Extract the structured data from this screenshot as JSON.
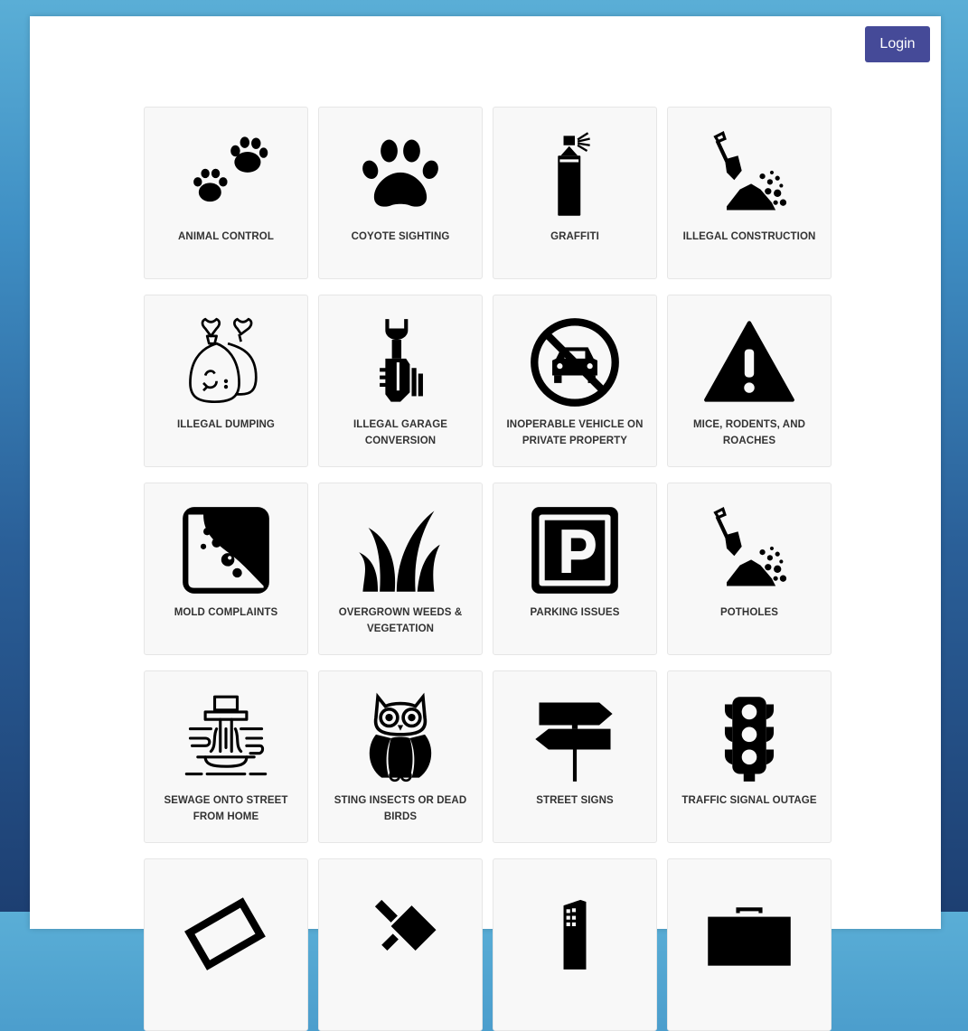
{
  "header": {
    "login_label": "Login"
  },
  "services": [
    {
      "label": "ANIMAL CONTROL",
      "icon": "paw-prints-icon"
    },
    {
      "label": "COYOTE SIGHTING",
      "icon": "paw-icon"
    },
    {
      "label": "GRAFFITI",
      "icon": "spray-can-icon"
    },
    {
      "label": "ILLEGAL CONSTRUCTION",
      "icon": "shovel-dirt-icon"
    },
    {
      "label": "ILLEGAL DUMPING",
      "icon": "garbage-bags-icon"
    },
    {
      "label": "ILLEGAL GARAGE CONVERSION",
      "icon": "wrench-hand-icon"
    },
    {
      "label": "INOPERABLE VEHICLE ON PRIVATE PROPERTY",
      "icon": "no-car-icon"
    },
    {
      "label": "MICE, RODENTS, AND ROACHES",
      "icon": "warning-icon"
    },
    {
      "label": "MOLD COMPLAINTS",
      "icon": "mold-icon"
    },
    {
      "label": "OVERGROWN WEEDS & VEGETATION",
      "icon": "grass-icon"
    },
    {
      "label": "PARKING ISSUES",
      "icon": "parking-icon"
    },
    {
      "label": "POTHOLES",
      "icon": "shovel-dirt-icon"
    },
    {
      "label": "SEWAGE ONTO STREET FROM HOME",
      "icon": "sewage-icon"
    },
    {
      "label": "STING INSECTS OR DEAD BIRDS",
      "icon": "owl-icon"
    },
    {
      "label": "STREET SIGNS",
      "icon": "street-sign-icon"
    },
    {
      "label": "TRAFFIC SIGNAL OUTAGE",
      "icon": "traffic-light-icon"
    },
    {
      "label": "",
      "icon": "tilted-sign-icon"
    },
    {
      "label": "",
      "icon": "broken-sign-icon"
    },
    {
      "label": "",
      "icon": "building-icon"
    },
    {
      "label": "",
      "icon": "briefcase-icon"
    }
  ]
}
